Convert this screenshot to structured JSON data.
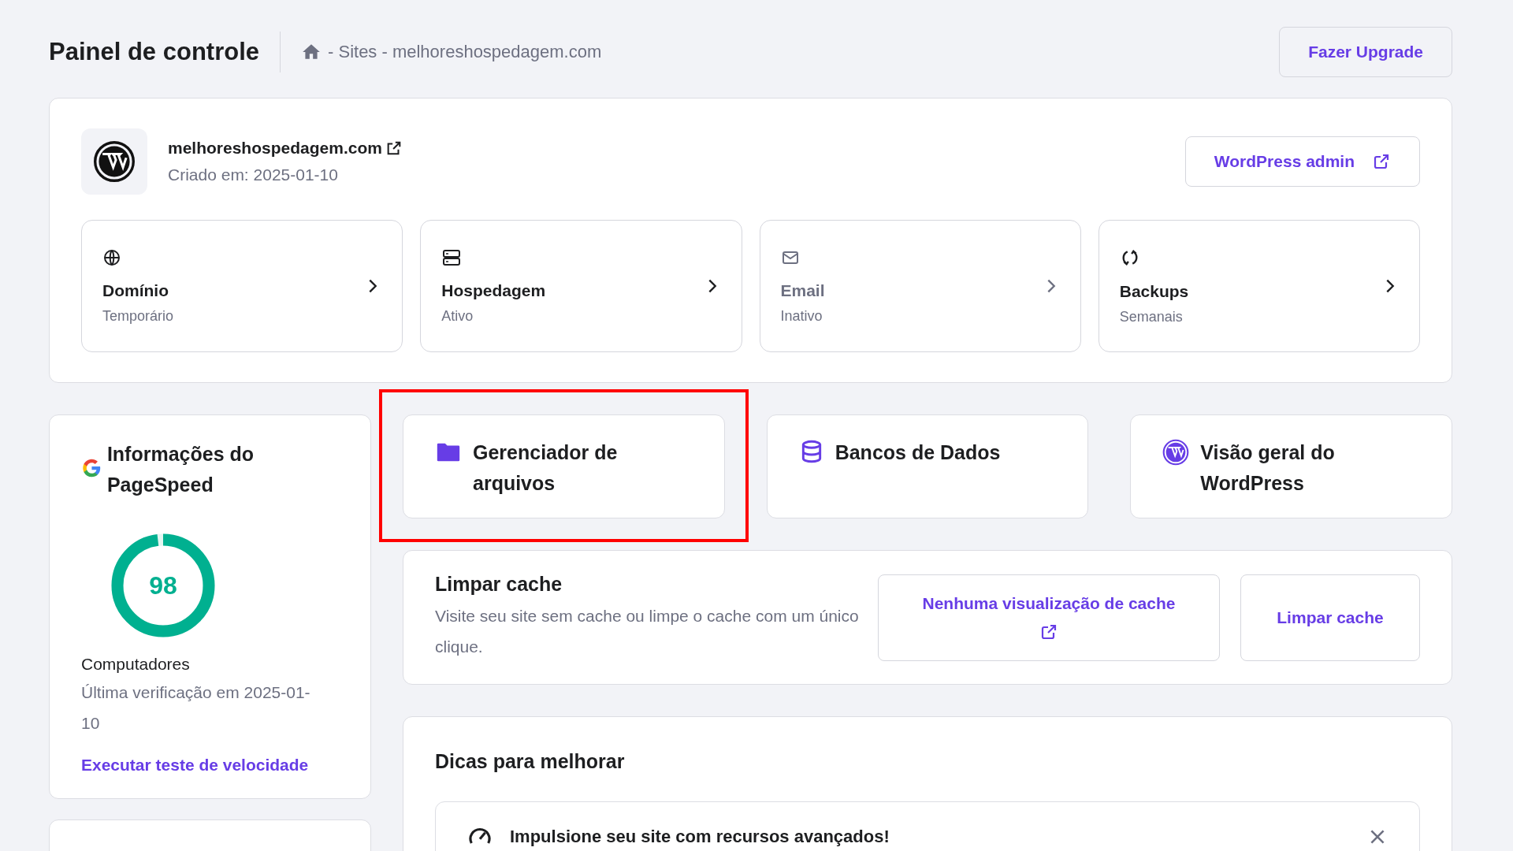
{
  "header": {
    "title": "Painel de controle",
    "breadcrumb": "- Sites - melhoreshospedagem.com",
    "upgrade_button": "Fazer Upgrade"
  },
  "site": {
    "domain": "melhoreshospedagem.com",
    "created": "Criado em: 2025-01-10",
    "admin_button": "WordPress admin"
  },
  "services": [
    {
      "kind": "globe",
      "title": "Domínio",
      "status": "Temporário",
      "disabled": false
    },
    {
      "kind": "server",
      "title": "Hospedagem",
      "status": "Ativo",
      "disabled": false
    },
    {
      "kind": "mail",
      "title": "Email",
      "status": "Inativo",
      "disabled": true
    },
    {
      "kind": "sync",
      "title": "Backups",
      "status": "Semanais",
      "disabled": false
    }
  ],
  "pagespeed": {
    "title": "Informações do PageSpeed",
    "score": "98",
    "level": 0.98,
    "device": "Computadores",
    "last_check": "Última verificação em 2025-01-10",
    "link": "Executar teste de velocidade"
  },
  "tools": [
    {
      "kind": "folder",
      "title": "Gerenciador de arquivos",
      "highlighted": true
    },
    {
      "kind": "database",
      "title": "Bancos de Dados",
      "highlighted": false
    },
    {
      "kind": "wordpress",
      "title": "Visão geral do WordPress",
      "highlighted": false
    }
  ],
  "cache": {
    "title": "Limpar cache",
    "description": "Visite seu site sem cache ou limpe o cache com um único clique.",
    "preview_button": "Nenhuma visualização de cache",
    "clear_button": "Limpar cache"
  },
  "tips": {
    "title": "Dicas para melhorar",
    "items": [
      {
        "text": "Impulsione seu site com recursos avançados!"
      }
    ]
  }
}
